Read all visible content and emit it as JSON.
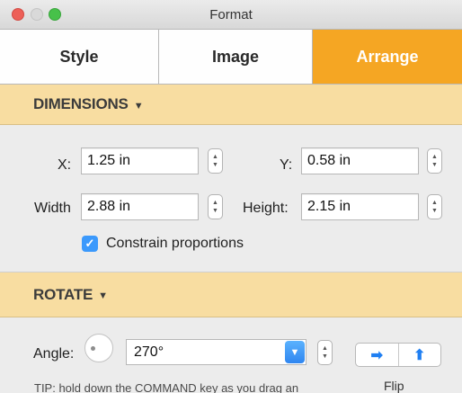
{
  "window": {
    "title": "Format"
  },
  "tabs": [
    {
      "label": "Style",
      "active": false
    },
    {
      "label": "Image",
      "active": false
    },
    {
      "label": "Arrange",
      "active": true
    }
  ],
  "colors": {
    "accent": "#f5a623",
    "section_bg": "#f8dda1",
    "control_blue": "#3b99fc"
  },
  "dimensions": {
    "header": "DIMENSIONS",
    "x_label": "X:",
    "x_value": "1.25 in",
    "y_label": "Y:",
    "y_value": "0.58 in",
    "width_label": "Width",
    "width_value": "2.88 in",
    "height_label": "Height:",
    "height_value": "2.15 in",
    "constrain_label": "Constrain proportions",
    "constrain_checked": true
  },
  "rotate": {
    "header": "ROTATE",
    "angle_label": "Angle:",
    "angle_value": "270°",
    "flip_label": "Flip",
    "flip_horizontal_icon": "arrow-right-icon",
    "flip_vertical_icon": "arrow-up-icon",
    "tip": "TIP: hold down the COMMAND key as you drag an"
  }
}
